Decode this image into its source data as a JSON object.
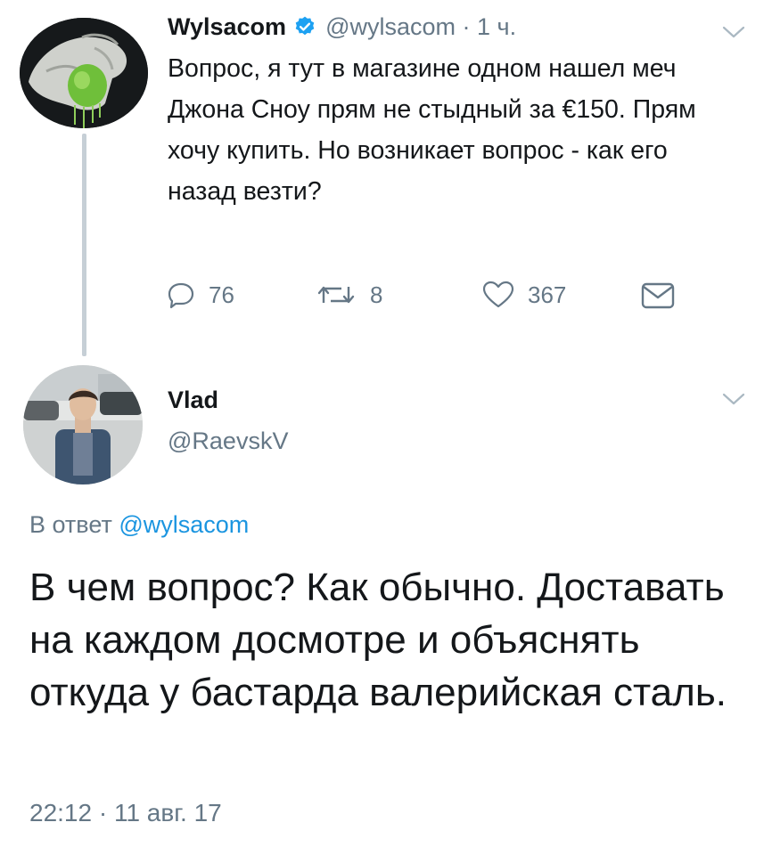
{
  "tweet1": {
    "author_name": "Wylsacom",
    "handle_time": "@wylsacom · 1 ч.",
    "text": "Вопрос, я тут в магазине одном нашел меч Джона Сноу прям не стыдный за €150. Прям хочу купить. Но возникает вопрос - как его назад везти?",
    "replies": "76",
    "retweets": "8",
    "likes": "367"
  },
  "tweet2": {
    "author_name": "Vlad",
    "handle": "@RaevskV",
    "reply_prefix": "В ответ ",
    "reply_handle": "@wylsacom",
    "text": "В чем вопрос? Как обычно. Доставать на каждом досмотре и объяснять откуда у бастарда валерийская сталь.",
    "timestamp": "22:12 · 11 авг. 17"
  },
  "colors": {
    "text": "#14171a",
    "muted": "#657786",
    "link": "#1b95e0",
    "verified": "#1da1f2",
    "thread_line": "#c6cfd6"
  },
  "icons": [
    "verified-badge-icon",
    "chevron-down-icon",
    "reply-icon",
    "retweet-icon",
    "like-icon",
    "direct-message-icon"
  ]
}
